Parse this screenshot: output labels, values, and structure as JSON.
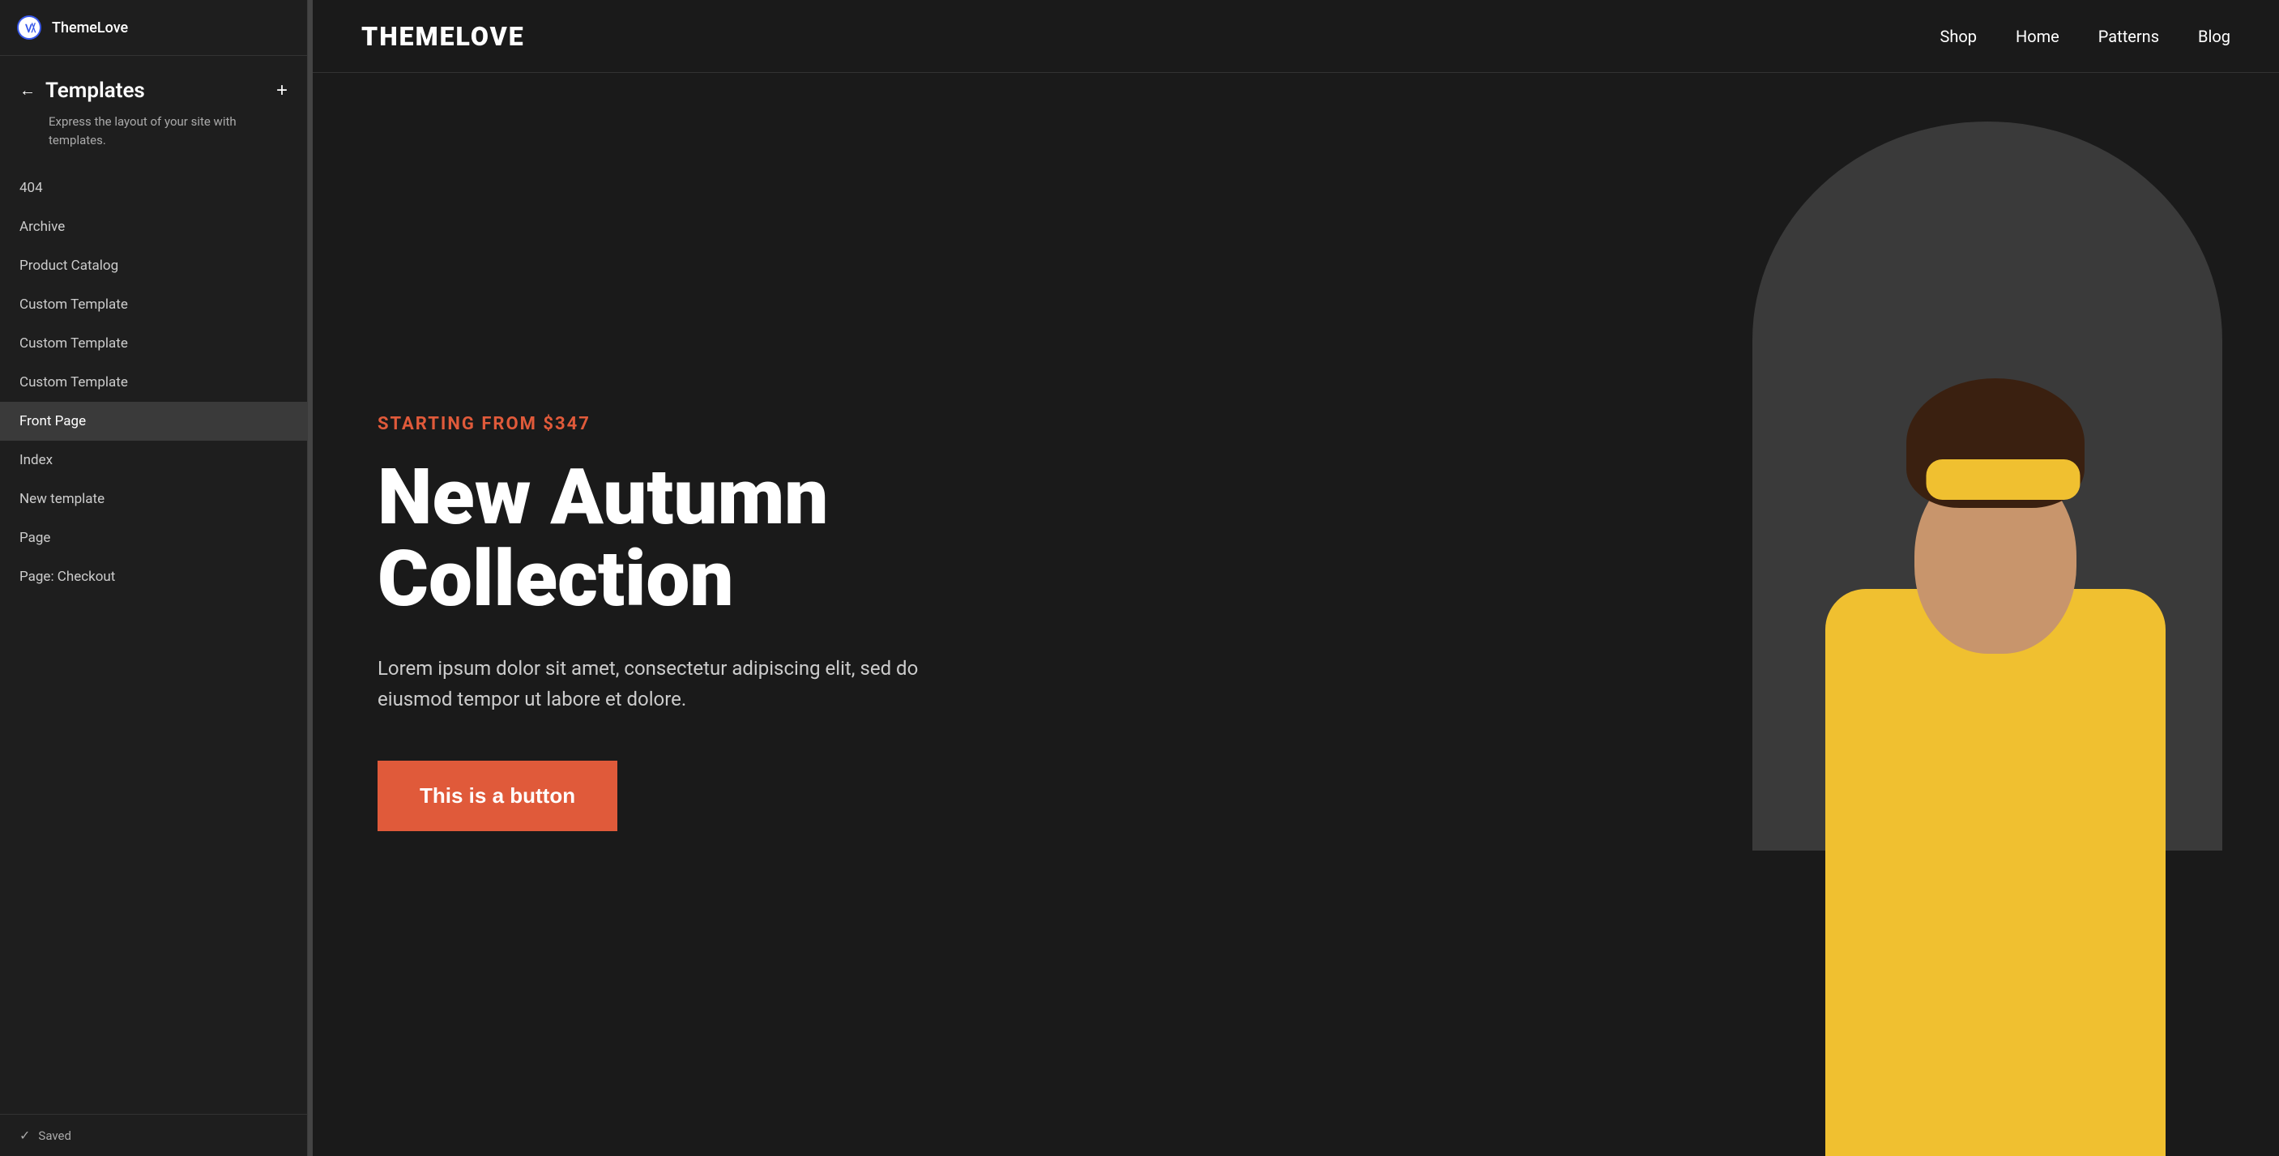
{
  "sidebar": {
    "top_bar": {
      "logo_alt": "WordPress Logo",
      "site_name": "ThemeLove"
    },
    "back_icon": "←",
    "title": "Templates",
    "add_icon": "+",
    "description": "Express the layout of your site with templates.",
    "nav_items": [
      {
        "id": "404",
        "label": "404",
        "active": false
      },
      {
        "id": "archive",
        "label": "Archive",
        "active": false
      },
      {
        "id": "product-catalog",
        "label": "Product Catalog",
        "active": false
      },
      {
        "id": "custom-template-1",
        "label": "Custom Template",
        "active": false
      },
      {
        "id": "custom-template-2",
        "label": "Custom Template",
        "active": false
      },
      {
        "id": "custom-template-3",
        "label": "Custom Template",
        "active": false
      },
      {
        "id": "front-page",
        "label": "Front Page",
        "active": true
      },
      {
        "id": "index",
        "label": "Index",
        "active": false
      },
      {
        "id": "new-template",
        "label": "New template",
        "active": false
      },
      {
        "id": "page",
        "label": "Page",
        "active": false
      },
      {
        "id": "page-checkout",
        "label": "Page: Checkout",
        "active": false
      }
    ],
    "footer": {
      "check_icon": "✓",
      "status": "Saved"
    }
  },
  "preview": {
    "header": {
      "logo": "THEMELOVE",
      "nav": [
        {
          "id": "shop",
          "label": "Shop"
        },
        {
          "id": "home",
          "label": "Home"
        },
        {
          "id": "patterns",
          "label": "Patterns"
        },
        {
          "id": "blog",
          "label": "Blog"
        }
      ]
    },
    "hero": {
      "subtitle": "Starting from $347",
      "title_line1": "New Autumn",
      "title_line2": "Collection",
      "body": "Lorem ipsum dolor sit amet, consectetur adipiscing elit, sed do eiusmod tempor ut labore et dolore.",
      "button_label": "This is a button",
      "button_color": "#e05a3a"
    }
  }
}
